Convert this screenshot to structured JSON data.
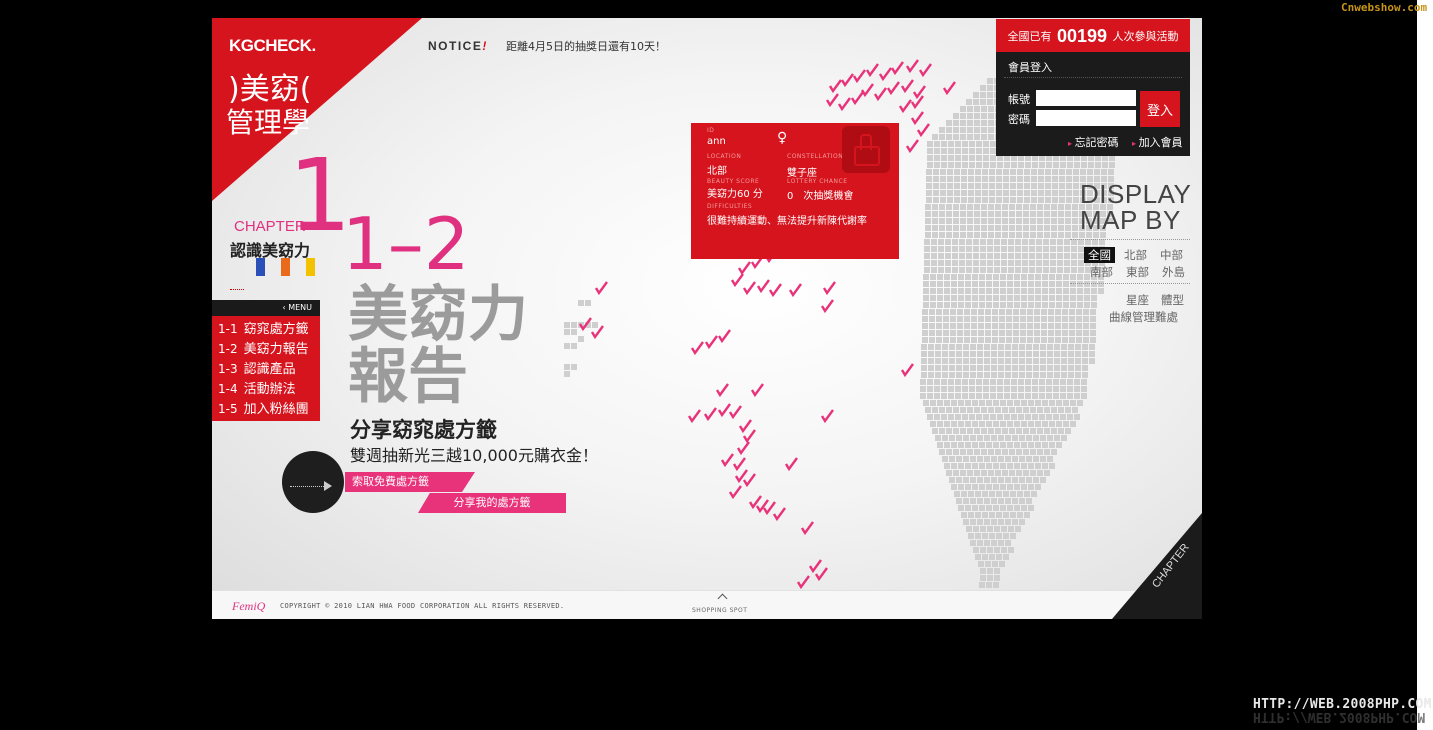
{
  "watermarks": {
    "top": "Cnwebshow.com",
    "bottom": "HTTP://WEB.2008PHP.COM"
  },
  "logo": {
    "brand": "KGCHECK.",
    "title_line1": ")美窈(",
    "title_line2": "管理學"
  },
  "chapter": {
    "number_big": "1",
    "word": "CHAPTER",
    "subtitle": "認識美窈力",
    "section": "1–2",
    "flag_colors": [
      "#2b4fb8",
      "#e86a1a",
      "#f2c200"
    ]
  },
  "notice": {
    "label": "NOTICE",
    "mark": "!",
    "text": "距離4月5日的抽獎日還有10天！"
  },
  "menu": {
    "header": "‹ MENU",
    "items": [
      {
        "num": "1-1",
        "label": "窈窕處方籤"
      },
      {
        "num": "1-2",
        "label": "美窈力報告"
      },
      {
        "num": "1-3",
        "label": "認識產品"
      },
      {
        "num": "1-4",
        "label": "活動辦法"
      },
      {
        "num": "1-5",
        "label": "加入粉絲團"
      }
    ]
  },
  "hero": {
    "big_line1": "美窈力",
    "big_line2": "報告",
    "share_title": "分享窈窕處方籤",
    "share_sub": "雙週抽新光三越10,000元購衣金！",
    "btn_free": "索取免費處方籤",
    "btn_share": "分享我的處方籤"
  },
  "popup": {
    "labels": {
      "id": "ID",
      "location": "LOCATION",
      "constellation": "CONSTELLATION",
      "beauty_score": "BEAUTY SCORE",
      "chance": "LOTTERY CHANCE",
      "difficulties": "DIFFICULTIES"
    },
    "name": "ann",
    "location": "北部",
    "constellation": "雙子座",
    "score": "美窈力60 分",
    "chances": "0　次抽獎機會",
    "difficulty": "很難持續運動、無法提升新陳代謝率"
  },
  "login": {
    "count_prefix": "全國已有",
    "count": "00199",
    "count_suffix": "人次參與活動",
    "title": "會員登入",
    "account_label": "帳號",
    "password_label": "密碼",
    "button": "登入",
    "forgot": "忘記密碼",
    "join": "加入會員"
  },
  "display": {
    "line1": "DISPLAY",
    "line2": "MAP BY",
    "regions": [
      "全國",
      "北部",
      "中部",
      "南部",
      "東部",
      "外島"
    ],
    "active_region": "全國",
    "filters": [
      "星座",
      "體型",
      "曲線管理難處"
    ]
  },
  "footer": {
    "brand": "FemiQ",
    "copyright": "COPYRIGHT © 2010 LIAN HWA FOOD CORPORATION ALL RIGHTS RESERVED.",
    "shopping": "SHOPPING SPOT",
    "chapter": "CHAPTER"
  },
  "colors": {
    "red": "#d6141e",
    "pink": "#e8327a",
    "magenta": "#e03080",
    "dark": "#1b1b1b",
    "map_tile": "#cfcfcf"
  },
  "map": {
    "marker_count": 62
  }
}
